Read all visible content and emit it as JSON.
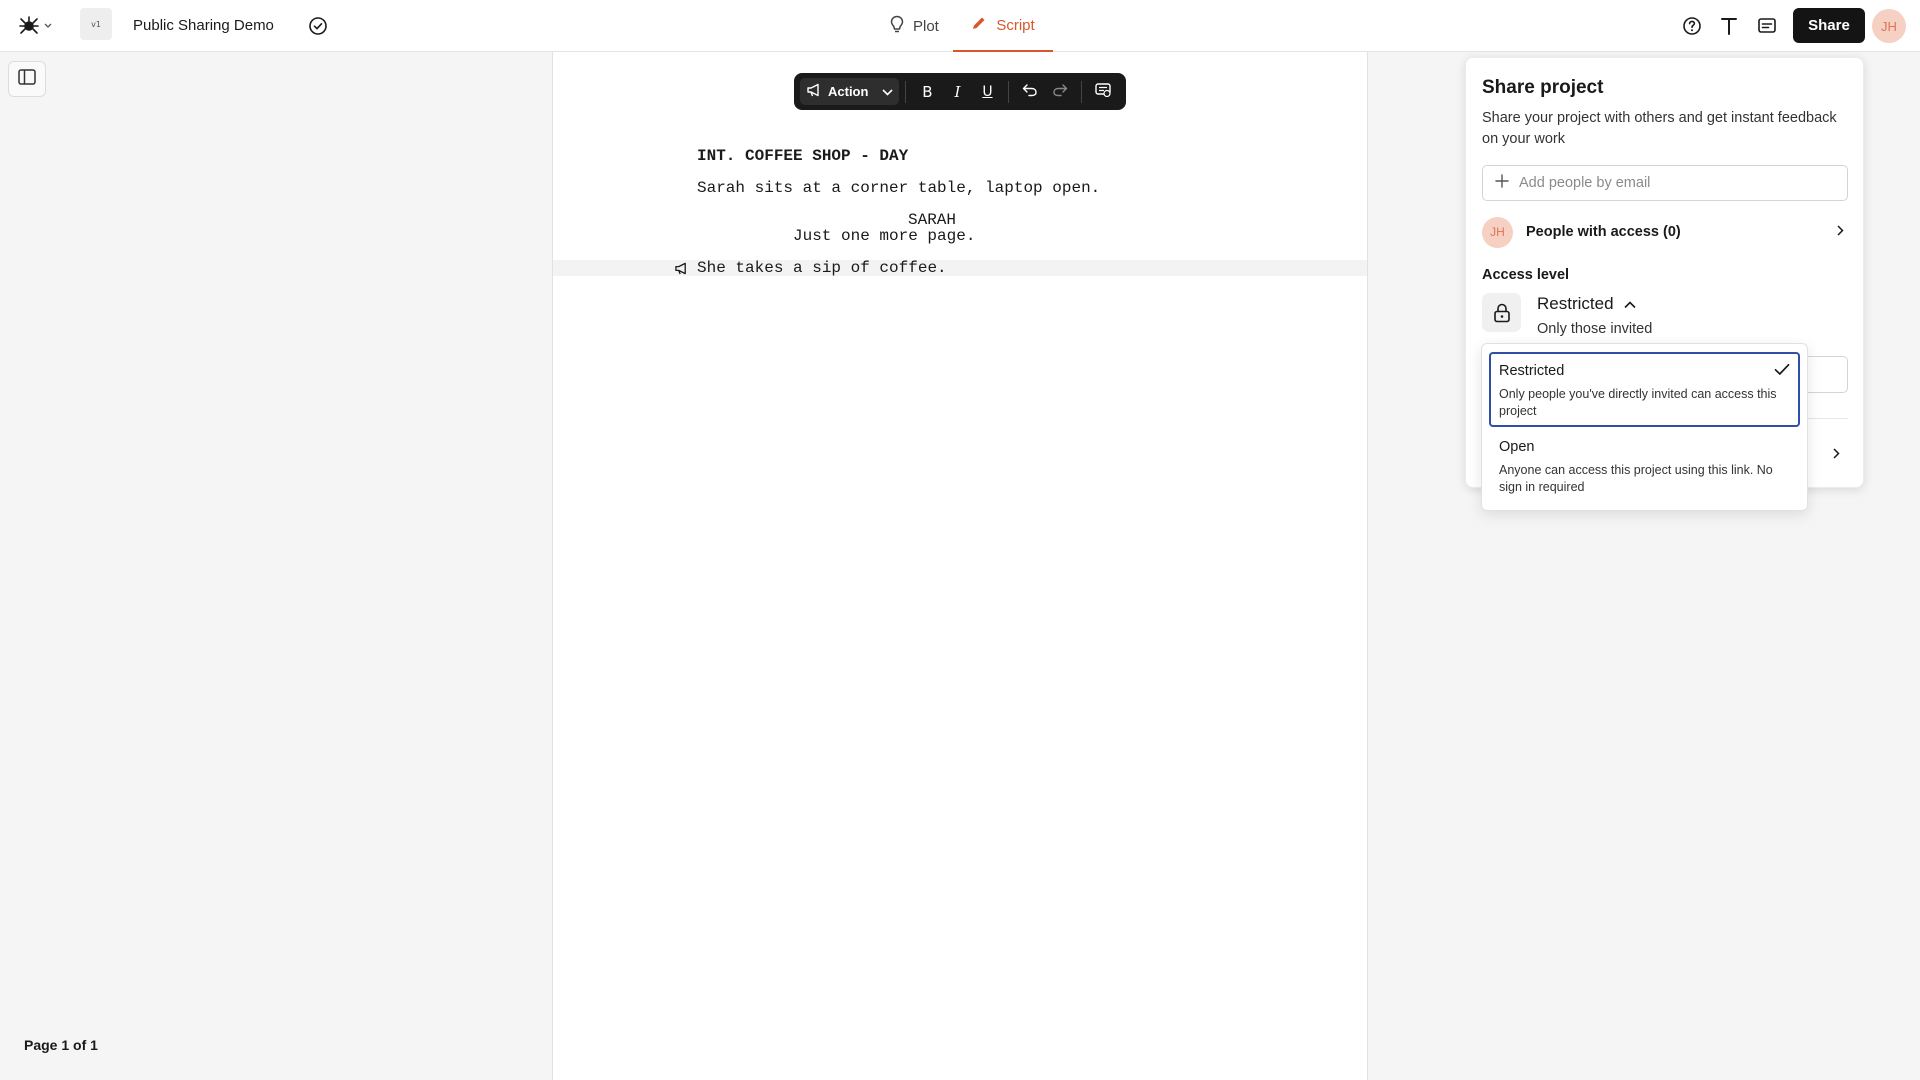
{
  "app": {
    "project_title": "Public Sharing Demo",
    "doc_thumb_label": "v1"
  },
  "tabs": [
    {
      "label": "Plot",
      "active": false
    },
    {
      "label": "Script",
      "active": true
    }
  ],
  "header": {
    "share_label": "Share",
    "user_initials": "JH"
  },
  "toolbar": {
    "element_type": "Action",
    "bold": "B",
    "italic": "I",
    "underline": "U"
  },
  "script": {
    "scene_heading": "INT. COFFEE SHOP - DAY",
    "action_1": "Sarah sits at a corner table, laptop open.",
    "character": "SARAH",
    "dialogue": "Just one more page.",
    "action_2": "She takes a sip of coffee."
  },
  "footer": {
    "page_count": "Page 1 of 1"
  },
  "share_panel": {
    "title": "Share project",
    "description": "Share your project with others and get instant feedback on your work",
    "email_placeholder": "Add people by email",
    "people_initials": "JH",
    "people_label": "People with access (0)",
    "access_label": "Access level",
    "access_value": "Restricted",
    "access_sub": "Only those invited"
  },
  "access_dropdown": {
    "options": [
      {
        "title": "Restricted",
        "description": "Only people you've directly invited can access this project",
        "selected": true
      },
      {
        "title": "Open",
        "description": "Anyone can access this project using this link. No sign in required",
        "selected": false
      }
    ]
  },
  "colors": {
    "accent": "#d9572b",
    "selected_border": "#2f4fa8",
    "share_button": "#141414",
    "avatar_bg": "#f5d0c3"
  },
  "icons": [
    "app-logo-icon",
    "saved-check-icon",
    "lightbulb-icon",
    "pencil-icon",
    "help-icon",
    "typography-icon",
    "comments-icon",
    "sidebar-icon",
    "megaphone-icon",
    "undo-icon",
    "redo-icon",
    "comment-add-icon",
    "plus-icon",
    "chevron-right-icon",
    "lock-icon",
    "chevron-up-icon",
    "check-icon"
  ]
}
